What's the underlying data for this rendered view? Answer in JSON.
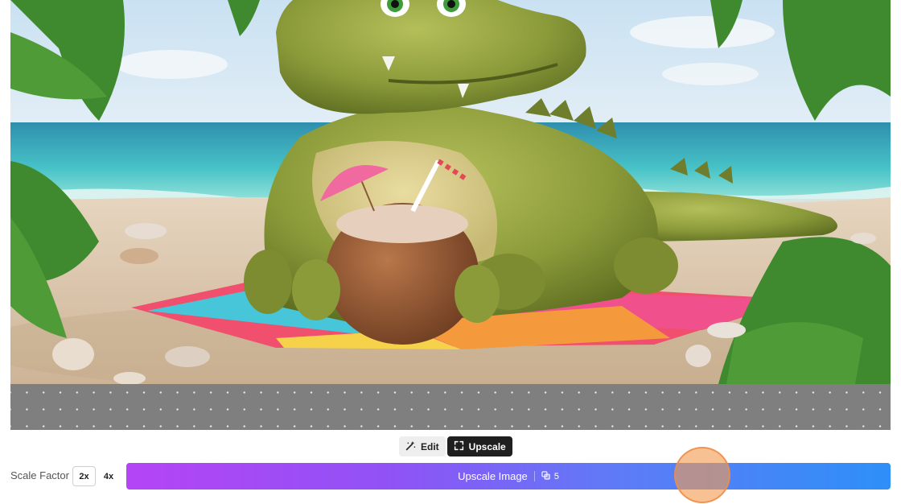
{
  "modes": {
    "edit_label": "Edit",
    "upscale_label": "Upscale",
    "active": "upscale"
  },
  "scale": {
    "label": "Scale Factor",
    "options": [
      "2x",
      "4x"
    ],
    "selected": "2x"
  },
  "action": {
    "label": "Upscale Image",
    "credits": "5"
  },
  "icons": {
    "edit": "magic-wand-icon",
    "upscale": "expand-icon",
    "credits": "credits-icon"
  },
  "colors": {
    "gradient_start": "#b544f5",
    "gradient_end": "#2e8ff8",
    "active_mode_bg": "#1f1f1f",
    "cursor_highlight": "#f39b52"
  }
}
